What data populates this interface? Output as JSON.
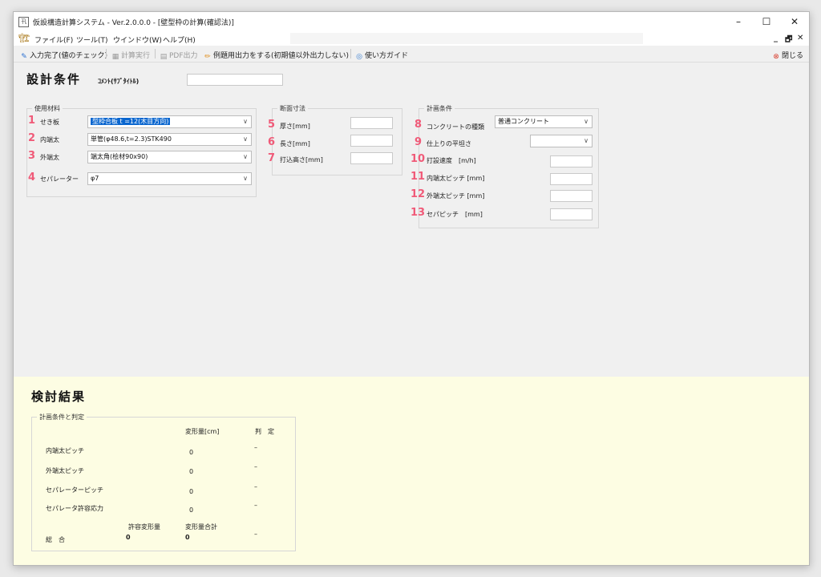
{
  "window": {
    "title": "仮設構造計算システム - Ver.2.0.0.0 - [壁型枠の計算(確認法)]",
    "app_icon": "app-icon",
    "min": "–",
    "max": "☐",
    "close": "✕"
  },
  "menu": {
    "items": [
      "ファイル(F)",
      "ツール(T)",
      "ウインドウ(W)",
      "ヘルプ(H)"
    ],
    "mdi_min": "_",
    "mdi_restore": "🗗",
    "mdi_close": "✕"
  },
  "toolbar": {
    "input_done": "入力完了(値のチェック)",
    "calc_run": "計算実行",
    "pdf_out": "PDF出力",
    "example_out": "例題用出力をする(初期値以外出力しない)",
    "guide": "使い方ガイド",
    "close": "閉じる"
  },
  "design": {
    "heading": "設計条件",
    "comment_label": "ｺﾒﾝﾄ(ｻﾌﾞﾀｲﾄﾙ)",
    "comment_value": ""
  },
  "materials": {
    "caption": "使用材料",
    "rows": [
      {
        "num": "1",
        "label": "せき板",
        "value": "型枠合板 t =12(木目方向)"
      },
      {
        "num": "2",
        "label": "内端太",
        "value": "単管(φ48.6,t=2.3)STK490"
      },
      {
        "num": "3",
        "label": "外端太",
        "value": "端太角(桧材90x90)"
      },
      {
        "num": "4",
        "label": "セパレーター",
        "value": "φ7"
      }
    ]
  },
  "section": {
    "caption": "断面寸法",
    "rows": [
      {
        "num": "5",
        "label": "厚さ[mm]",
        "value": ""
      },
      {
        "num": "6",
        "label": "長さ[mm]",
        "value": ""
      },
      {
        "num": "7",
        "label": "打込高さ[mm]",
        "value": ""
      }
    ]
  },
  "plan": {
    "caption": "計画条件",
    "concrete": {
      "num": "8",
      "label": "コンクリートの種類",
      "value": "普通コンクリート"
    },
    "flatness": {
      "num": "9",
      "label": "仕上りの平坦さ",
      "value": ""
    },
    "rows": [
      {
        "num": "10",
        "label": "打設速度　[m/h]",
        "value": ""
      },
      {
        "num": "11",
        "label": "内端太ピッチ [mm]",
        "value": ""
      },
      {
        "num": "12",
        "label": "外端太ピッチ [mm]",
        "value": ""
      },
      {
        "num": "13",
        "label": "セパピッチ　[mm]",
        "value": ""
      }
    ]
  },
  "results": {
    "heading": "検討結果",
    "caption": "計画条件と判定",
    "col_deform": "変形量[cm]",
    "col_judge": "判　定",
    "rows": [
      {
        "label": "内端太ピッチ",
        "value": "0",
        "judge": "–"
      },
      {
        "label": "外端太ピッチ",
        "value": "0",
        "judge": "–"
      },
      {
        "label": "セパレーターピッチ",
        "value": "0",
        "judge": "–"
      },
      {
        "label": "セパレータ許容応力",
        "value": "0",
        "judge": "–"
      }
    ],
    "allow_label": "許容変形量",
    "sum_label": "変形量合計",
    "total_label": "総　合",
    "allow_value": "0",
    "sum_value": "0",
    "total_judge": "–"
  }
}
